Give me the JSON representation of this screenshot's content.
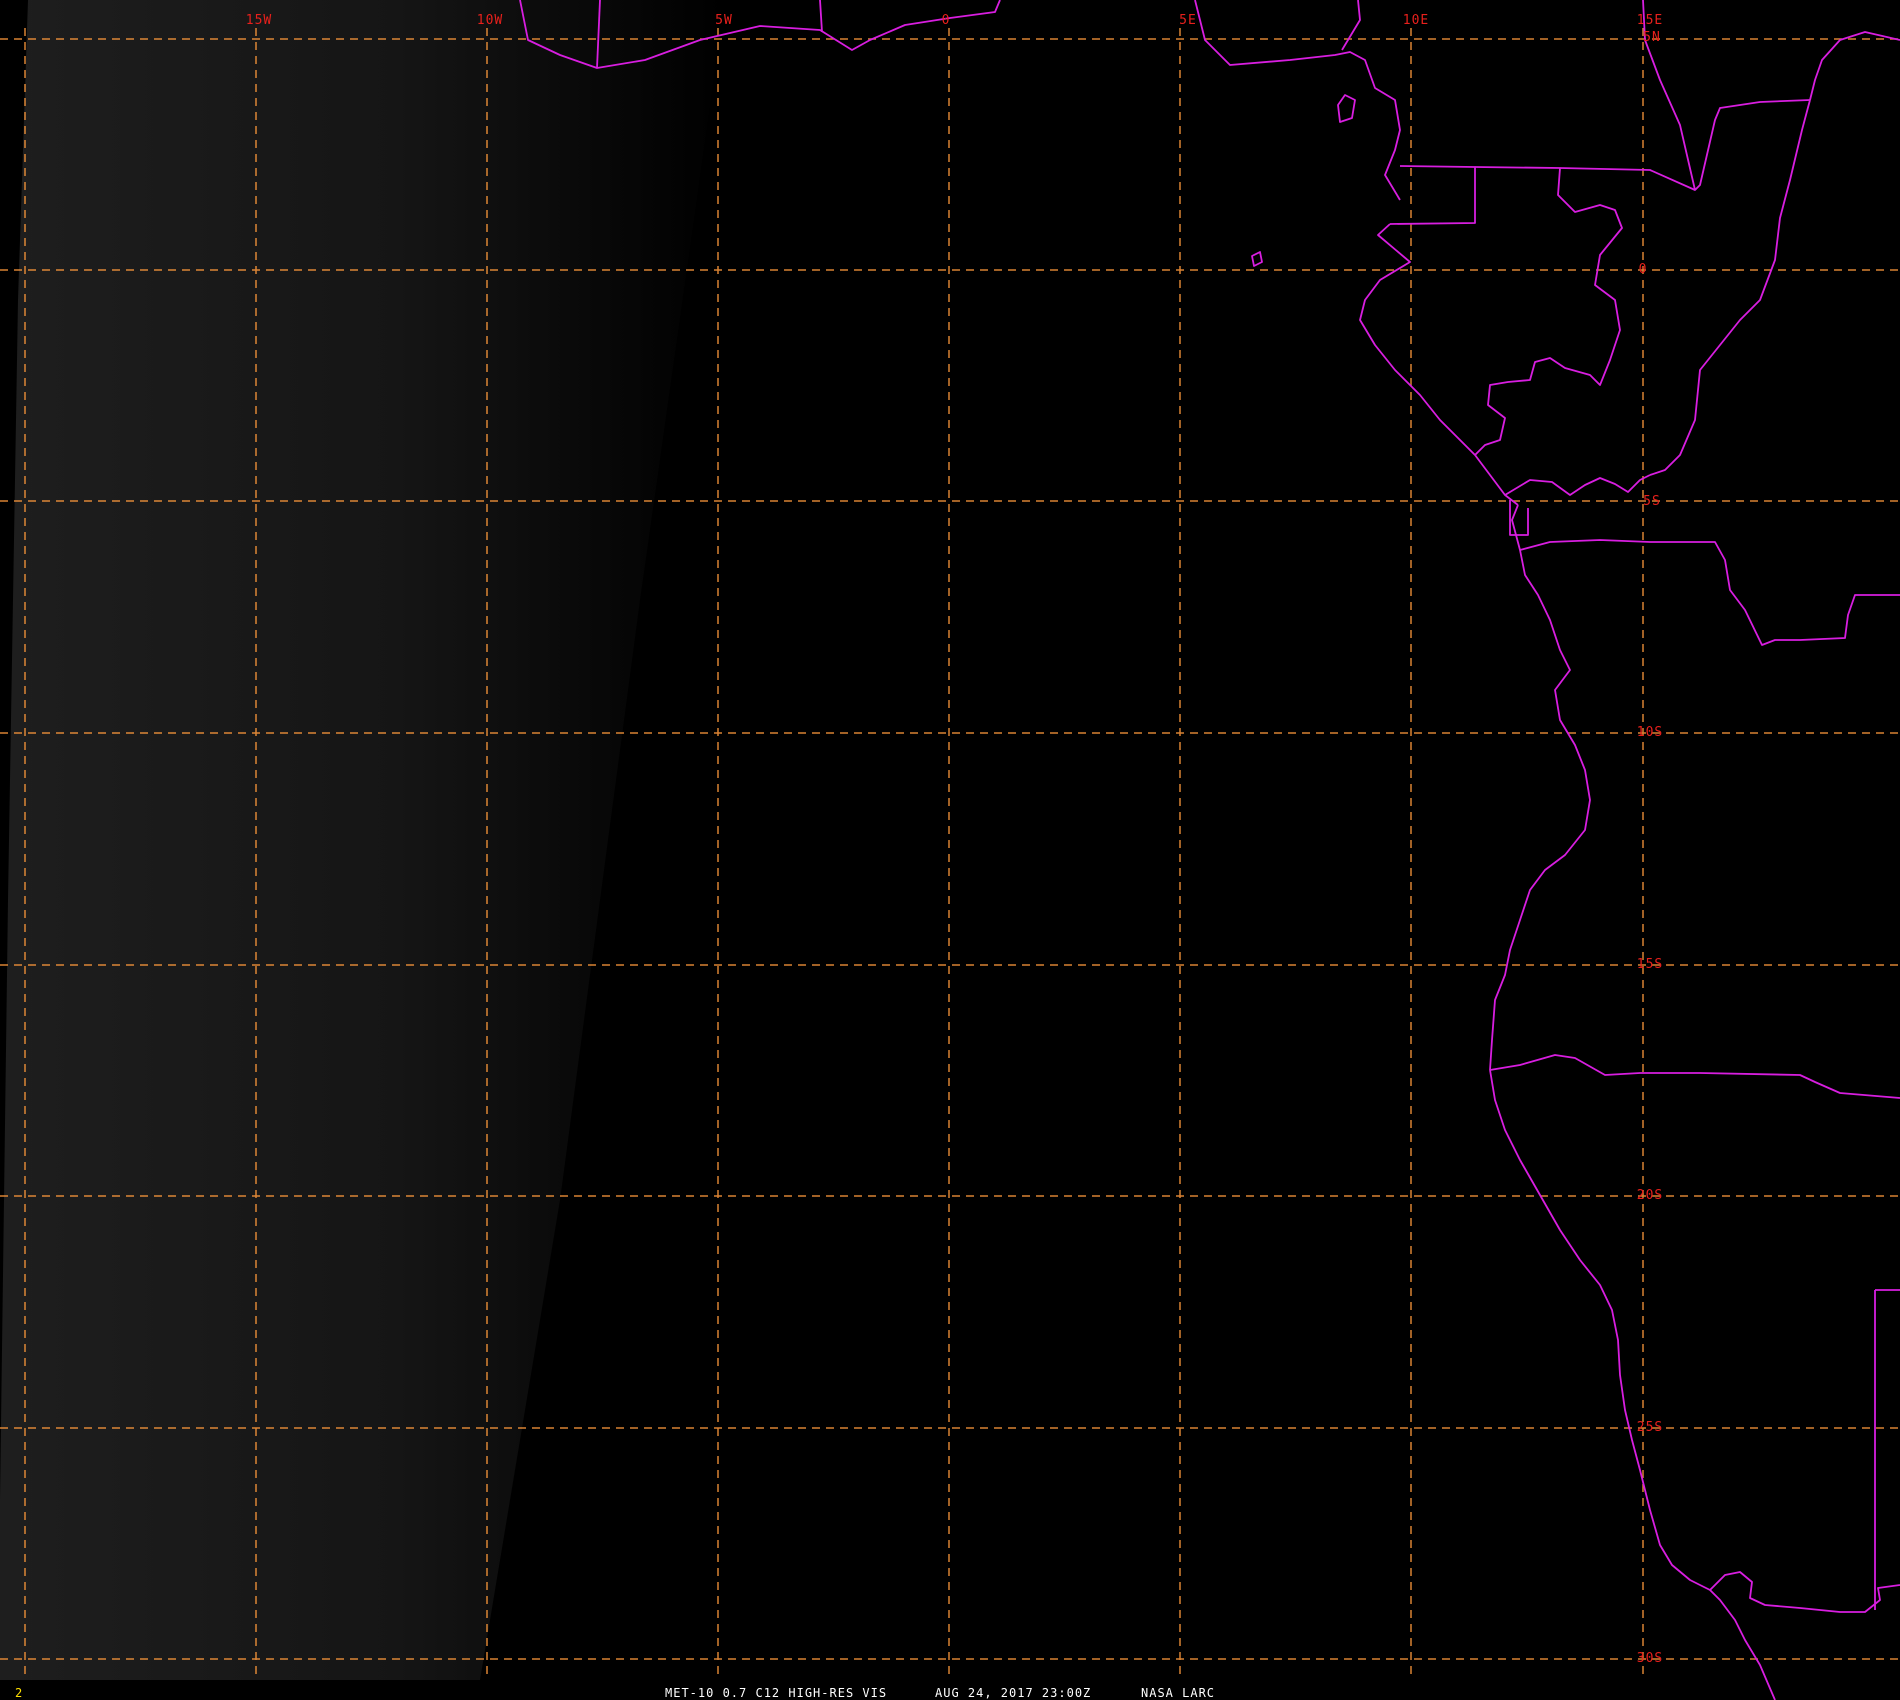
{
  "map": {
    "longitude_labels": [
      "15W",
      "10W",
      "5W",
      "0",
      "5E",
      "10E",
      "15E"
    ],
    "latitude_labels": [
      "5N",
      "0",
      "5S",
      "10S",
      "15S",
      "20S",
      "25S",
      "30S"
    ],
    "grid_visible": true,
    "grid_style": "dashed",
    "colors": {
      "background": "#000000",
      "night_glow": "#1c1c1c",
      "grid": "#ff9a3c",
      "grid_label": "#e8201c",
      "borders": "#d81ee0",
      "caption": "#ffffff",
      "frame_number": "#ffe000"
    }
  },
  "footer": {
    "frame_number": "2",
    "satellite": "MET-10 0.7 C12 HIGH-RES VIS",
    "datetime": "AUG 24, 2017 23:00Z",
    "source": "NASA LARC"
  }
}
